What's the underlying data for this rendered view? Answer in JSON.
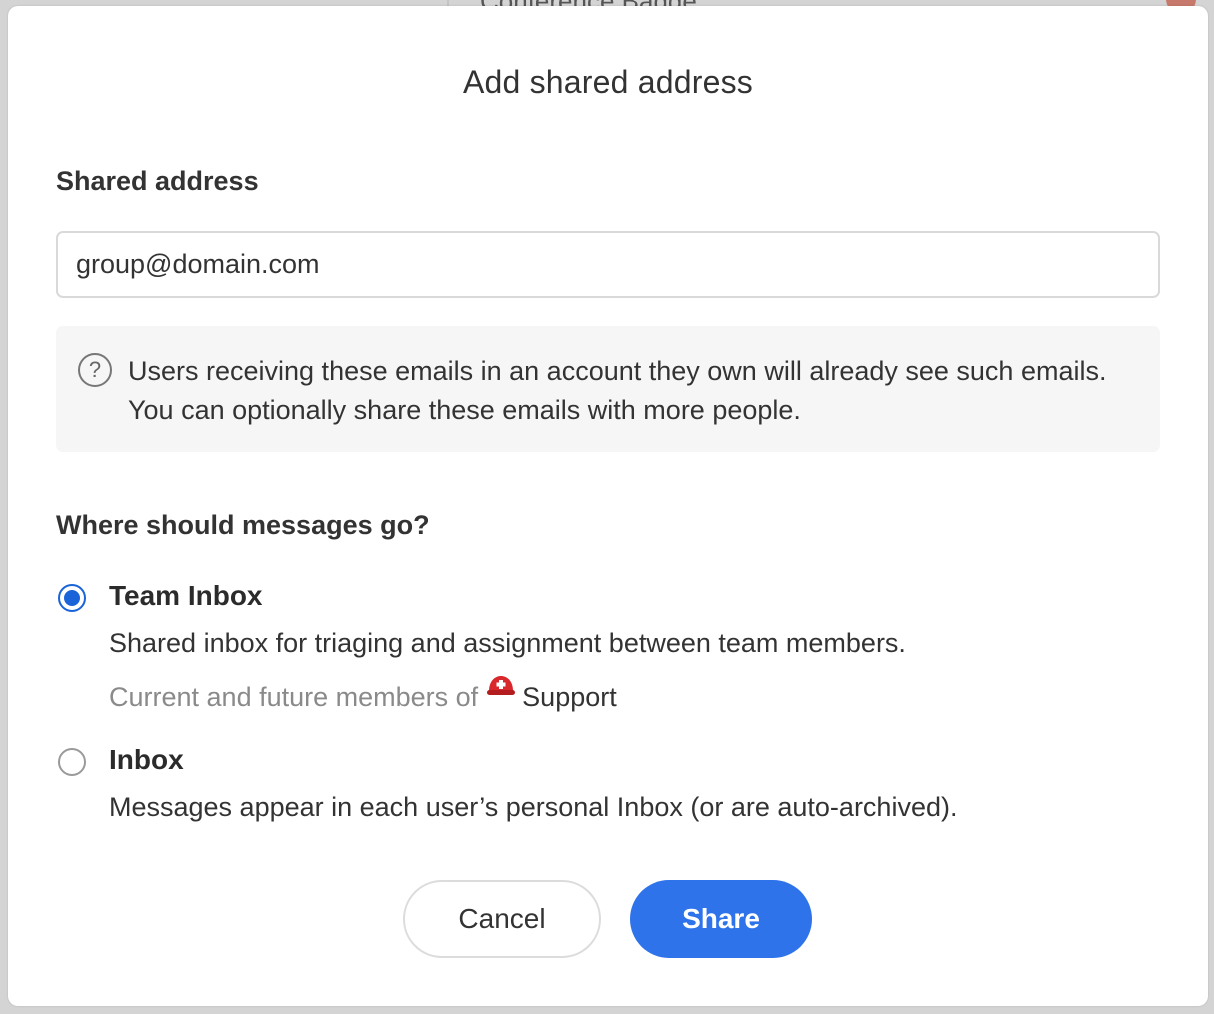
{
  "background": {
    "partial_text": "Conference Badge"
  },
  "dialog": {
    "title": "Add shared address",
    "shared_address_label": "Shared address",
    "shared_address_value": "group@domain.com",
    "info_icon": "question-circle-icon",
    "info_text": "Users receiving these emails in an account they own will already see such emails. You can optionally share these emails with more people.",
    "destination_heading": "Where should messages go?",
    "options": [
      {
        "title": "Team Inbox",
        "description": "Shared inbox for triaging and assignment between team members.",
        "members_prefix": "Current and future members of",
        "team_icon": "red-helmet-icon",
        "team_name": "Support",
        "selected": true
      },
      {
        "title": "Inbox",
        "description": "Messages appear in each user’s personal Inbox (or are auto-archived).",
        "selected": false
      }
    ],
    "cancel_label": "Cancel",
    "share_label": "Share"
  },
  "colors": {
    "accent": "#2e73ea",
    "radio_selected": "#1a63d8"
  }
}
